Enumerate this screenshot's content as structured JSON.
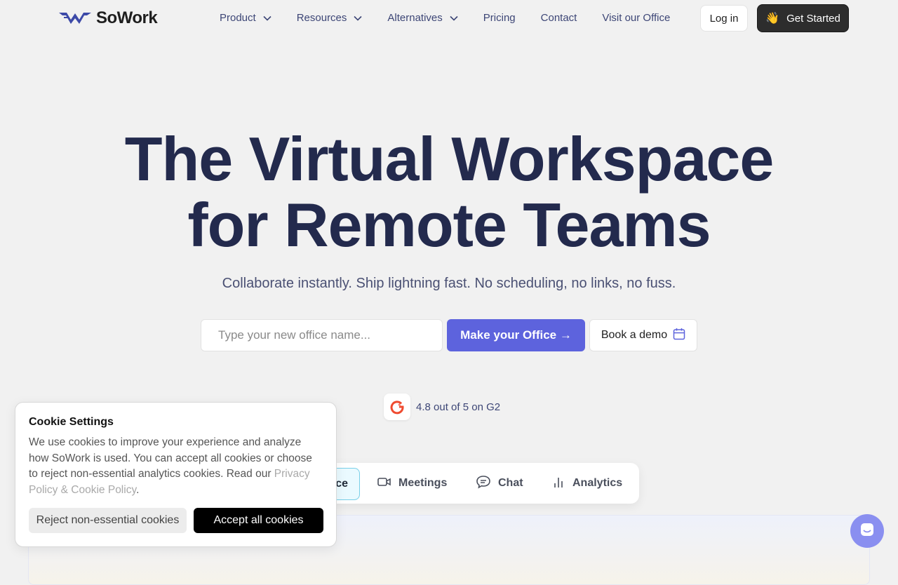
{
  "brand": {
    "name": "SoWork"
  },
  "nav": {
    "items": [
      {
        "label": "Product",
        "has_dropdown": true
      },
      {
        "label": "Resources",
        "has_dropdown": true
      },
      {
        "label": "Alternatives",
        "has_dropdown": true
      },
      {
        "label": "Pricing",
        "has_dropdown": false
      },
      {
        "label": "Contact",
        "has_dropdown": false
      },
      {
        "label": "Visit our Office",
        "has_dropdown": false
      }
    ],
    "login_label": "Log in",
    "get_started_label": "Get Started",
    "get_started_icon": "waving-hand-icon"
  },
  "hero": {
    "title_line1": "The Virtual Workspace",
    "title_line2": "for Remote Teams",
    "subtitle": "Collaborate instantly. Ship lightning fast. No scheduling, no links, no fuss.",
    "input_placeholder": "Type your new office name...",
    "primary_cta": "Make your Office →",
    "demo_cta": "Book a demo",
    "demo_icon": "calendar-icon"
  },
  "rating": {
    "badge_icon": "g2-logo-icon",
    "text": "4.8 out of 5 on G2"
  },
  "feature_tabs": {
    "active_partial_label": "ce",
    "items": [
      {
        "label": "Meetings",
        "icon": "video-camera-icon"
      },
      {
        "label": "Chat",
        "icon": "chat-bubble-icon"
      },
      {
        "label": "Analytics",
        "icon": "bar-chart-icon"
      }
    ]
  },
  "cookie": {
    "title": "Cookie Settings",
    "body": "We use cookies to improve your experience and analyze how SoWork is used. You can accept all cookies or choose to reject non-essential analytics cookies. Read our ",
    "link_text": "Privacy Policy & Cookie Policy",
    "body_end": ".",
    "reject_label": "Reject non-essential cookies",
    "accept_label": "Accept all cookies"
  },
  "colors": {
    "page_bg": "#f1f1f1",
    "heading": "#232a4d",
    "nav_text": "#3d4676",
    "primary": "#5d63dd",
    "dark_button": "#2d2d2d",
    "g2_red": "#ef4a2f",
    "chat_launcher": "#8a8ff0"
  }
}
